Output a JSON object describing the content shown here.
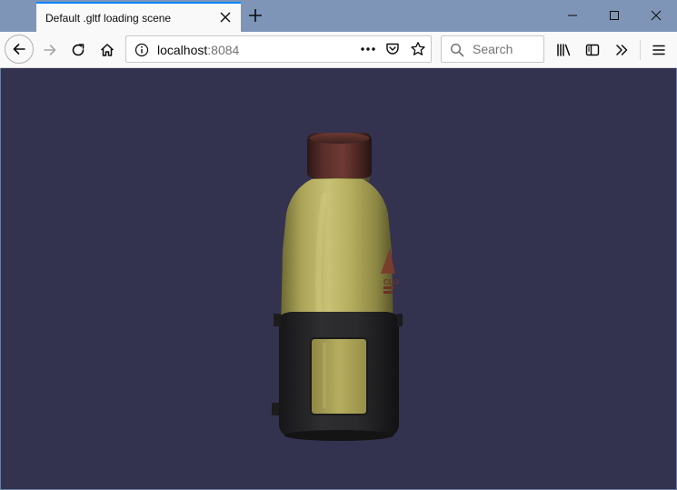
{
  "browser": {
    "tab": {
      "title": "Default .gltf loading scene"
    },
    "url": {
      "host": "localhost",
      "port": ":8084"
    },
    "search": {
      "placeholder": "Search"
    },
    "icons": {
      "tab_close": "close-icon",
      "new_tab": "plus-icon",
      "minimize": "minimize-icon",
      "maximize": "maximize-icon",
      "close": "close-icon",
      "back": "arrow-left-icon",
      "forward": "arrow-right-icon",
      "reload": "reload-icon",
      "home": "home-icon",
      "info": "info-icon",
      "page_actions": "ellipsis-icon",
      "pocket": "pocket-icon",
      "bookmark": "star-icon",
      "library": "library-icon",
      "sidebar": "sidebar-icon",
      "overflow": "chevron-double-right-icon",
      "menu": "hamburger-menu-icon"
    },
    "colors": {
      "tabstrip": "#7e95b8",
      "active_tab_accent": "#0a84ff",
      "toolbar": "#f9f9fa"
    }
  },
  "scene": {
    "background_color": "#33324f",
    "model": "water-bottle",
    "label_text": "CLO"
  }
}
